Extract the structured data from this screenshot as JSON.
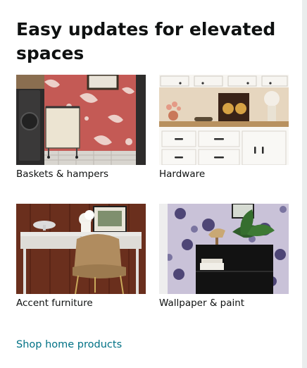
{
  "card": {
    "title": "Easy updates for elevated spaces",
    "tiles": [
      {
        "label": "Baskets & hampers",
        "image": "laundry-room-hamper-photo"
      },
      {
        "label": "Hardware",
        "image": "kitchen-cabinet-hardware-photo"
      },
      {
        "label": "Accent furniture",
        "image": "desk-and-chair-photo"
      },
      {
        "label": "Wallpaper & paint",
        "image": "floral-wallpaper-cabinet-photo"
      }
    ],
    "link_label": "Shop home products"
  },
  "colors": {
    "link": "#007185",
    "text": "#0f1111",
    "page_edge": "#eaeded"
  }
}
